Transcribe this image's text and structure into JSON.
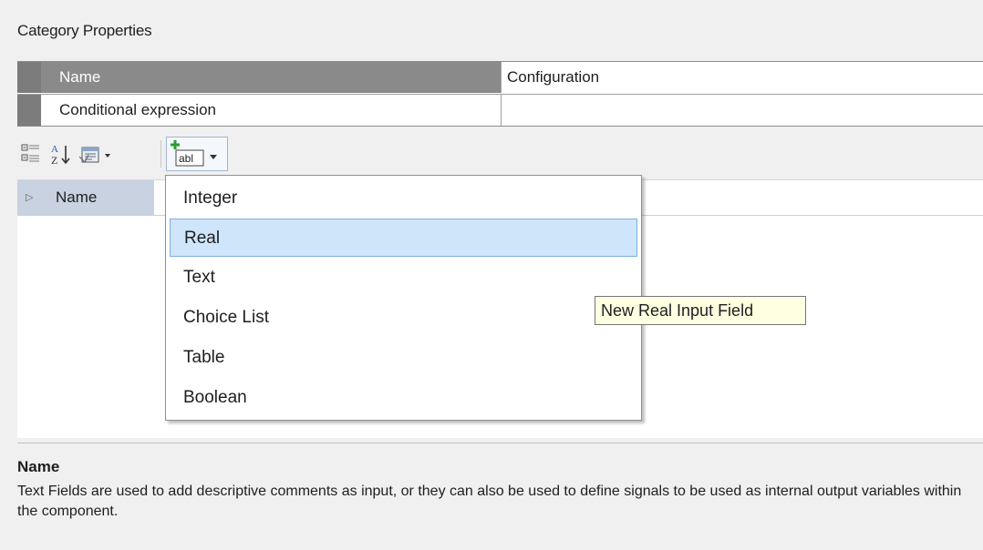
{
  "panel": {
    "title": "Category Properties"
  },
  "category_grid": {
    "rows": [
      {
        "key": "Name",
        "value": "Configuration"
      },
      {
        "key": "Conditional expression",
        "value": ""
      }
    ]
  },
  "toolbar": {
    "categorized_icon": "categorized-icon",
    "alphabetical_icon": "sort-alphabetical-icon",
    "property_pages_icon": "property-pages-icon",
    "add_field_icon": "add-text-field-icon",
    "add_field_label": "abl"
  },
  "property_list": {
    "rows": [
      {
        "key": "Name",
        "value": ""
      }
    ]
  },
  "dropdown": {
    "items": [
      {
        "label": "Integer"
      },
      {
        "label": "Real"
      },
      {
        "label": "Text"
      },
      {
        "label": "Choice List"
      },
      {
        "label": "Table"
      },
      {
        "label": "Boolean"
      }
    ],
    "highlighted": "Real"
  },
  "tooltip": {
    "text": "New Real Input Field"
  },
  "description": {
    "title": "Name",
    "text": "Text Fields are used to add descriptive comments as input, or they can also be used to define signals to be used as internal output variables within the component."
  }
}
